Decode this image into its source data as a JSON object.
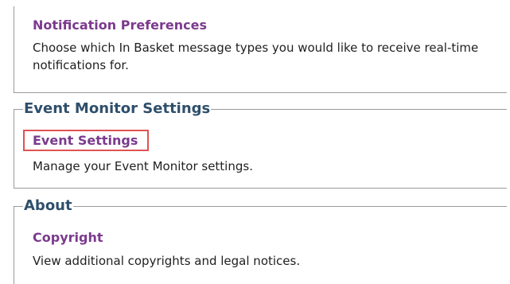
{
  "notification": {
    "link_label": "Notification Preferences",
    "description": "Choose which In Basket message types you would like to receive real-time notifications for."
  },
  "event_monitor": {
    "section_title": "Event Monitor Settings",
    "link_label": "Event Settings",
    "description": "Manage your Event Monitor settings.",
    "highlight_color": "#e05252"
  },
  "about": {
    "section_title": "About",
    "link_label": "Copyright",
    "description": "View additional copyrights and legal notices."
  },
  "colors": {
    "link": "#7b3a8e",
    "section_title": "#2f4f6b",
    "border": "#9a9a9a"
  }
}
